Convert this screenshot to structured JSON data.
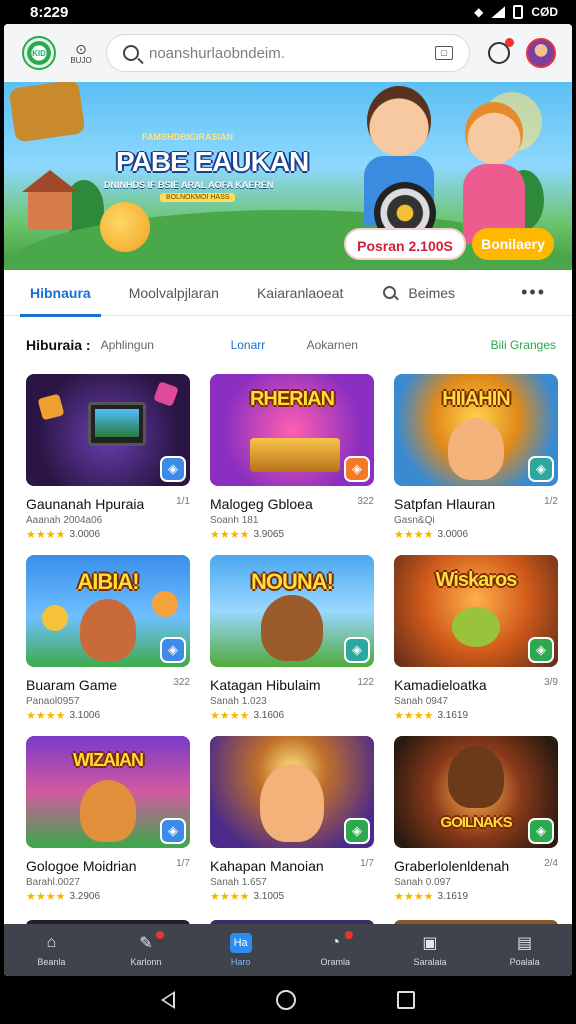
{
  "status": {
    "time": "8:229",
    "right": "CØD"
  },
  "topbar": {
    "logo_text": "KID",
    "location_label": "BUJO",
    "search_placeholder": "noanshurlaobndeim.",
    "icons": [
      "logo-icon",
      "location-pin-icon",
      "search-icon",
      "scan-icon",
      "notification-icon",
      "avatar"
    ]
  },
  "banner": {
    "kicker": "FAMSHDBIGIRASIAN",
    "title": "PABE EAUKAN",
    "subtitle": "DNINHDS IF BSIE ARAL AOFA KAEREN",
    "mini": "BOLNOKMOI HASS",
    "primary_button": "Posran 2.100S",
    "secondary_button": "Bonilaery",
    "colors": {
      "sky": "#5bc0f2",
      "grass": "#4aa84a",
      "primary_text": "#d0213c",
      "secondary_bg": "#ffb800"
    }
  },
  "tabs": {
    "items": [
      {
        "label": "Hibnaura",
        "active": true
      },
      {
        "label": "Moolvalpjlaran",
        "active": false
      },
      {
        "label": "Kaiaranlaoeat",
        "active": false
      }
    ],
    "search_label": "Beimes",
    "more_label": "•••"
  },
  "section": {
    "title": "Hiburaia :",
    "subtitle": "Aphlingun",
    "chip_active": "Lonarr",
    "chip_other": "Aokarnen",
    "link": "Bili Granges"
  },
  "games": [
    {
      "name": "Gaunanah Hpuraia",
      "rank": "1/1",
      "dev": "Aaanah 2004a06",
      "rating": "3.0006",
      "stars": "★★★★",
      "theme": "console",
      "badge_color": "#3d8be6"
    },
    {
      "name": "Malogeg Gbloea",
      "rank": "322",
      "dev": "Soanh 181",
      "rating": "3.9065",
      "stars": "★★★★",
      "theme": "treasure",
      "badge_color": "#f07a2a",
      "title_art": "RHERIAN"
    },
    {
      "name": "Satpfan Hlauran",
      "rank": "1/2",
      "dev": "Gasn&Qi",
      "rating": "3.0006",
      "stars": "★★★★",
      "theme": "kids",
      "badge_color": "#2ca8a0",
      "title_art": "HIIAHIN"
    },
    {
      "name": "Buaram Game",
      "rank": "322",
      "dev": "Panaol0957",
      "rating": "3.1006",
      "stars": "★★★★",
      "theme": "aibia",
      "badge_color": "#3d8be6",
      "title_art": "AIBIA!"
    },
    {
      "name": "Katagan Hibulaim",
      "rank": "122",
      "dev": "Sanah 1.023",
      "rating": "3.1606",
      "stars": "★★★★",
      "theme": "nouna",
      "badge_color": "#2ca8a0",
      "title_art": "NOUNA!"
    },
    {
      "name": "Kamadieloatka",
      "rank": "3/9",
      "dev": "Sanah 0947",
      "rating": "3.1619",
      "stars": "★★★★",
      "theme": "wiskros",
      "badge_color": "#2ca84e",
      "title_art": "Wiskaros"
    },
    {
      "name": "Gologoe Moidrian",
      "rank": "1/7",
      "dev": "Barahl.0027",
      "rating": "3.2906",
      "stars": "★★★★",
      "theme": "wizard",
      "badge_color": "#3d8be6",
      "title_art": "WIZAIAN"
    },
    {
      "name": "Kahapan Manoian",
      "rank": "1/7",
      "dev": "Sanah 1.657",
      "rating": "3.1005",
      "stars": "★★★★",
      "theme": "hero",
      "badge_color": "#2ca84e"
    },
    {
      "name": "Graberlolenldenah",
      "rank": "2/4",
      "dev": "Sanah 0.097",
      "rating": "3.1619",
      "stars": "★★★★",
      "theme": "warrior",
      "badge_color": "#2ca84e",
      "title_art": "GOILNAKS"
    }
  ],
  "bottom_nav": [
    {
      "label": "Beanla",
      "icon": "home-icon",
      "active": false,
      "dot": false
    },
    {
      "label": "Karlonn",
      "icon": "edit-icon",
      "active": false,
      "dot": true
    },
    {
      "label": "Haro",
      "icon": "games-icon",
      "active": true,
      "dot": false,
      "glyph": "Ha"
    },
    {
      "label": "Oramla",
      "icon": "download-icon",
      "active": false,
      "dot": true
    },
    {
      "label": "Saralaia",
      "icon": "library-icon",
      "active": false,
      "dot": false
    },
    {
      "label": "Poalala",
      "icon": "profile-icon",
      "active": false,
      "dot": false
    }
  ]
}
